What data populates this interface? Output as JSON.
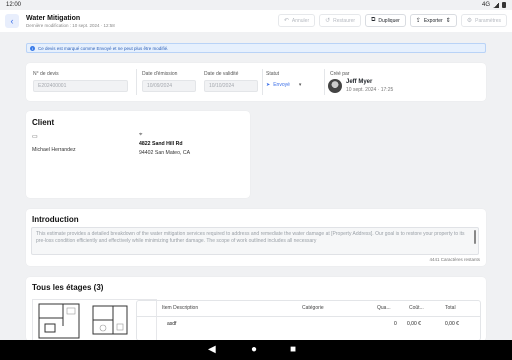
{
  "status_bar": {
    "time": "12:00",
    "network": "4G"
  },
  "header": {
    "title": "Water Mitigation",
    "subtitle": "Dernière modification : 10 sept. 2024 · 12:58",
    "actions": [
      {
        "label": "Annuler",
        "icon": "undo-icon",
        "enabled": false
      },
      {
        "label": "Restaurer",
        "icon": "restore-icon",
        "enabled": false
      },
      {
        "label": "Dupliquer",
        "icon": "copy-icon",
        "enabled": true
      },
      {
        "label": "Exporter",
        "icon": "export-icon",
        "enabled": true
      },
      {
        "label": "Paramètres",
        "icon": "gear-icon",
        "enabled": false
      }
    ]
  },
  "notice": "Ce devis est marqué comme Envoyé et ne peut plus être modifié.",
  "meta": {
    "quote_number_label": "N° de devis",
    "quote_number": "E202400001",
    "issue_date_label": "Date d'émission",
    "issue_date": "10/09/2024",
    "validity_date_label": "Date de validité",
    "validity_date": "10/10/2024",
    "status_label": "Statut",
    "status_value": "Envoyé",
    "created_by_label": "Créé par",
    "created_by_name": "Jeff Myer",
    "created_by_date": "10 sept. 2024 · 17:25"
  },
  "client": {
    "title": "Client",
    "name": "Michael Herrandez",
    "address_line1": "4822 Sand Hill Rd",
    "address_line2": "94402 San Mateo, CA"
  },
  "introduction": {
    "title": "Introduction",
    "text": "This estimate provides a detailed breakdown of the water mitigation services required to address and remediate the water damage at [Property Address]. Our goal is to restore your property to its pre-loss condition efficiently and effectively while minimizing further damage. The scope of work outlined includes all necessary",
    "counter": "4441 Caractères restants"
  },
  "etages": {
    "title": "Tous les étages (3)",
    "columns": [
      "Item Description",
      "Catégorie",
      "Qua...",
      "Coût...",
      "Total"
    ],
    "rows": [
      {
        "description": "asdf",
        "category": "",
        "quantity": "0",
        "cost": "0,00 €",
        "total": "0,00 €"
      }
    ]
  },
  "colors": {
    "accent": "#3a6ee8",
    "notice_bg": "#e6f0fd"
  }
}
